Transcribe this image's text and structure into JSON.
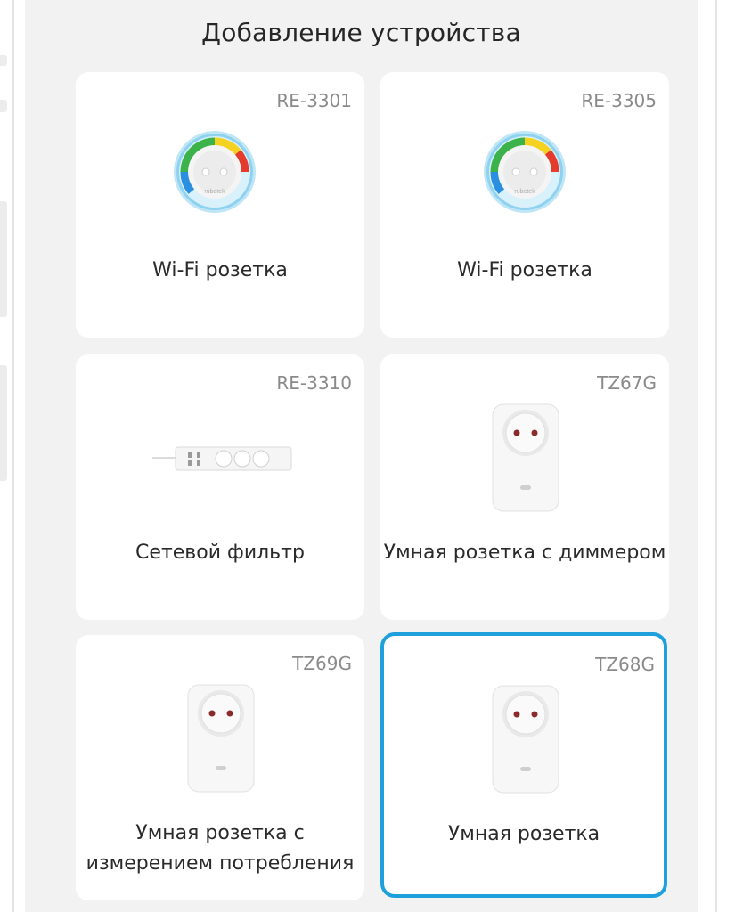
{
  "screen": {
    "title": "Добавление устройства"
  },
  "devices": [
    {
      "model": "RE-3301",
      "name": "Wi-Fi розетка",
      "icon": "round-wifi-socket-icon",
      "selected": false
    },
    {
      "model": "RE-3305",
      "name": "Wi-Fi розетка",
      "icon": "round-wifi-socket-icon",
      "selected": false
    },
    {
      "model": "RE-3310",
      "name": "Сетевой фильтр",
      "icon": "power-strip-icon",
      "selected": false
    },
    {
      "model": "TZ67G",
      "name": "Умная розетка с диммером",
      "icon": "plug-socket-icon",
      "selected": false
    },
    {
      "model": "TZ69G",
      "name": "Умная розетка с измерением потребления",
      "icon": "plug-socket-icon",
      "selected": false
    },
    {
      "model": "TZ68G",
      "name": "Умная розетка",
      "icon": "plug-socket-icon",
      "selected": true
    }
  ],
  "colors": {
    "accent": "#1ea0dc",
    "background": "#f2f2f2",
    "card": "#ffffff"
  }
}
